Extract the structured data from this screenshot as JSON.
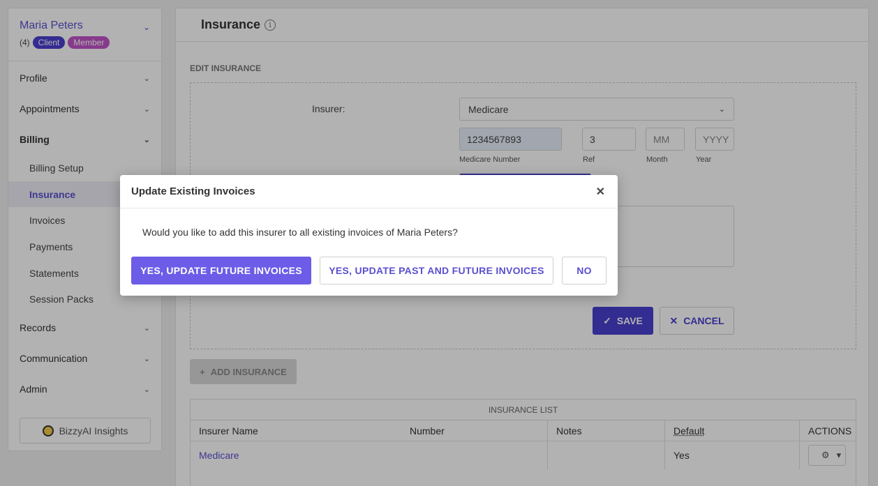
{
  "sidebar": {
    "client_name": "Maria Peters",
    "client_count": "(4)",
    "badges": [
      "Client",
      "Member"
    ],
    "items": [
      {
        "label": "Profile"
      },
      {
        "label": "Appointments"
      },
      {
        "label": "Billing"
      },
      {
        "label": "Records"
      },
      {
        "label": "Communication"
      },
      {
        "label": "Admin"
      }
    ],
    "billing_sub": [
      "Billing Setup",
      "Insurance",
      "Invoices",
      "Payments",
      "Statements",
      "Session Packs"
    ],
    "insights_label": "BizzyAI Insights"
  },
  "main": {
    "title": "Insurance",
    "section_label": "EDIT INSURANCE",
    "insurer_label": "Insurer:",
    "insurer_value": "Medicare",
    "medicare_number": "1234567893",
    "medicare_number_caption": "Medicare Number",
    "ref_value": "3",
    "ref_caption": "Ref",
    "month_placeholder": "MM",
    "month_caption": "Month",
    "year_placeholder": "YYYY",
    "year_caption": "Year",
    "save_label": "SAVE",
    "cancel_label": "CANCEL",
    "add_insurance_label": "ADD INSURANCE"
  },
  "insurance_list": {
    "title": "INSURANCE LIST",
    "columns": [
      "Insurer Name",
      "Number",
      "Notes",
      "Default",
      "ACTIONS"
    ],
    "rows": [
      {
        "insurer": "Medicare",
        "number": "",
        "notes": "",
        "default": "Yes"
      }
    ]
  },
  "modal": {
    "title": "Update Existing Invoices",
    "message": "Would you like to add this insurer to all existing invoices of Maria Peters?",
    "btn_future": "YES, UPDATE FUTURE INVOICES",
    "btn_past_future": "YES, UPDATE PAST AND FUTURE INVOICES",
    "btn_no": "NO"
  },
  "colors": {
    "accent": "#4a3fd0",
    "accent_light": "#6c5ce7",
    "badge_member": "#c254c9"
  }
}
